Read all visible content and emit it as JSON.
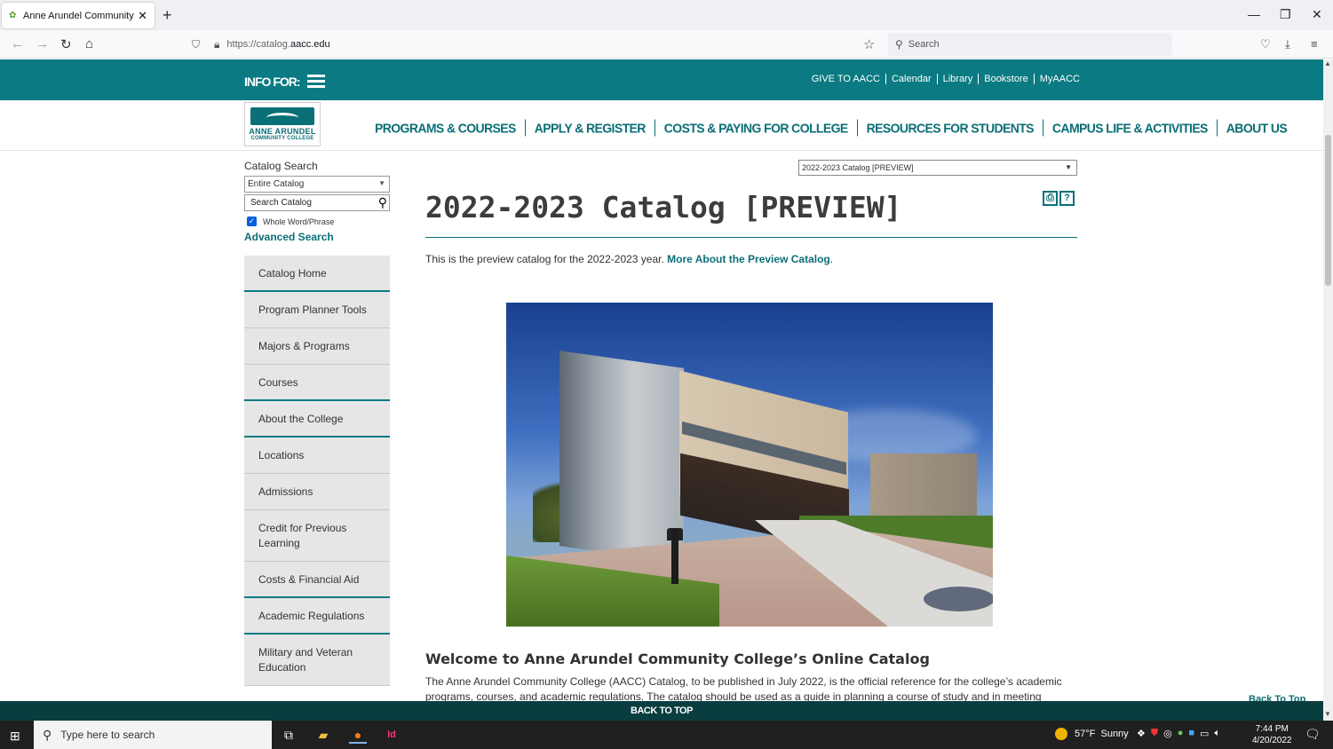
{
  "browser": {
    "tab_title": "Anne Arundel Community Coll",
    "url_proto": "https://catalog.",
    "url_host": "aacc.edu",
    "search_placeholder": "Search"
  },
  "site": {
    "info_for": "INFO FOR:",
    "top_links": [
      "GIVE TO AACC",
      "Calendar",
      "Library",
      "Bookstore",
      "MyAACC"
    ],
    "logo_line1": "ANNE ARUNDEL",
    "logo_line2": "COMMUNITY COLLEGE",
    "nav": [
      "PROGRAMS & COURSES",
      "APPLY & REGISTER",
      "COSTS & PAYING FOR COLLEGE",
      "RESOURCES FOR STUDENTS",
      "CAMPUS LIFE & ACTIVITIES",
      "ABOUT US"
    ]
  },
  "sidebar": {
    "catalog_search_label": "Catalog Search",
    "scope_selected": "Entire Catalog",
    "search_placeholder": "Search Catalog",
    "whole_word_label": "Whole Word/Phrase",
    "advanced_search": "Advanced Search",
    "menu": [
      {
        "label": "Catalog Home"
      },
      {
        "label": "Program Planner Tools"
      },
      {
        "label": "Majors & Programs"
      },
      {
        "label": "Courses"
      },
      {
        "label": "About the College"
      },
      {
        "label": "Locations"
      },
      {
        "label": "Admissions"
      },
      {
        "label": "Credit for Previous Learning"
      },
      {
        "label": "Costs & Financial Aid"
      },
      {
        "label": "Academic Regulations"
      },
      {
        "label": "Military and Veteran Education"
      }
    ]
  },
  "content": {
    "catalog_select": "2022-2023 Catalog [PREVIEW]",
    "page_title": "2022-2023 Catalog [PREVIEW]",
    "intro_text": "This is the preview catalog for the 2022-2023 year. ",
    "intro_link": "More About the Preview Catalog",
    "intro_end": ".",
    "welcome_heading": "Welcome to Anne Arundel Community College’s Online Catalog",
    "welcome_para": "The Anne Arundel Community College (AACC) Catalog, to be published in July 2022, is the official reference for the college’s academic programs, courses, and academic regulations. The catalog should be used as a guide in planning a course of study and in meeting",
    "back_to_top_right": "Back To Top",
    "back_to_top_bar": "BACK TO TOP"
  },
  "taskbar": {
    "search_text": "Type here to search",
    "weather_temp": "57°F",
    "weather_desc": "Sunny",
    "time": "7:44 PM",
    "date": "4/20/2022"
  }
}
